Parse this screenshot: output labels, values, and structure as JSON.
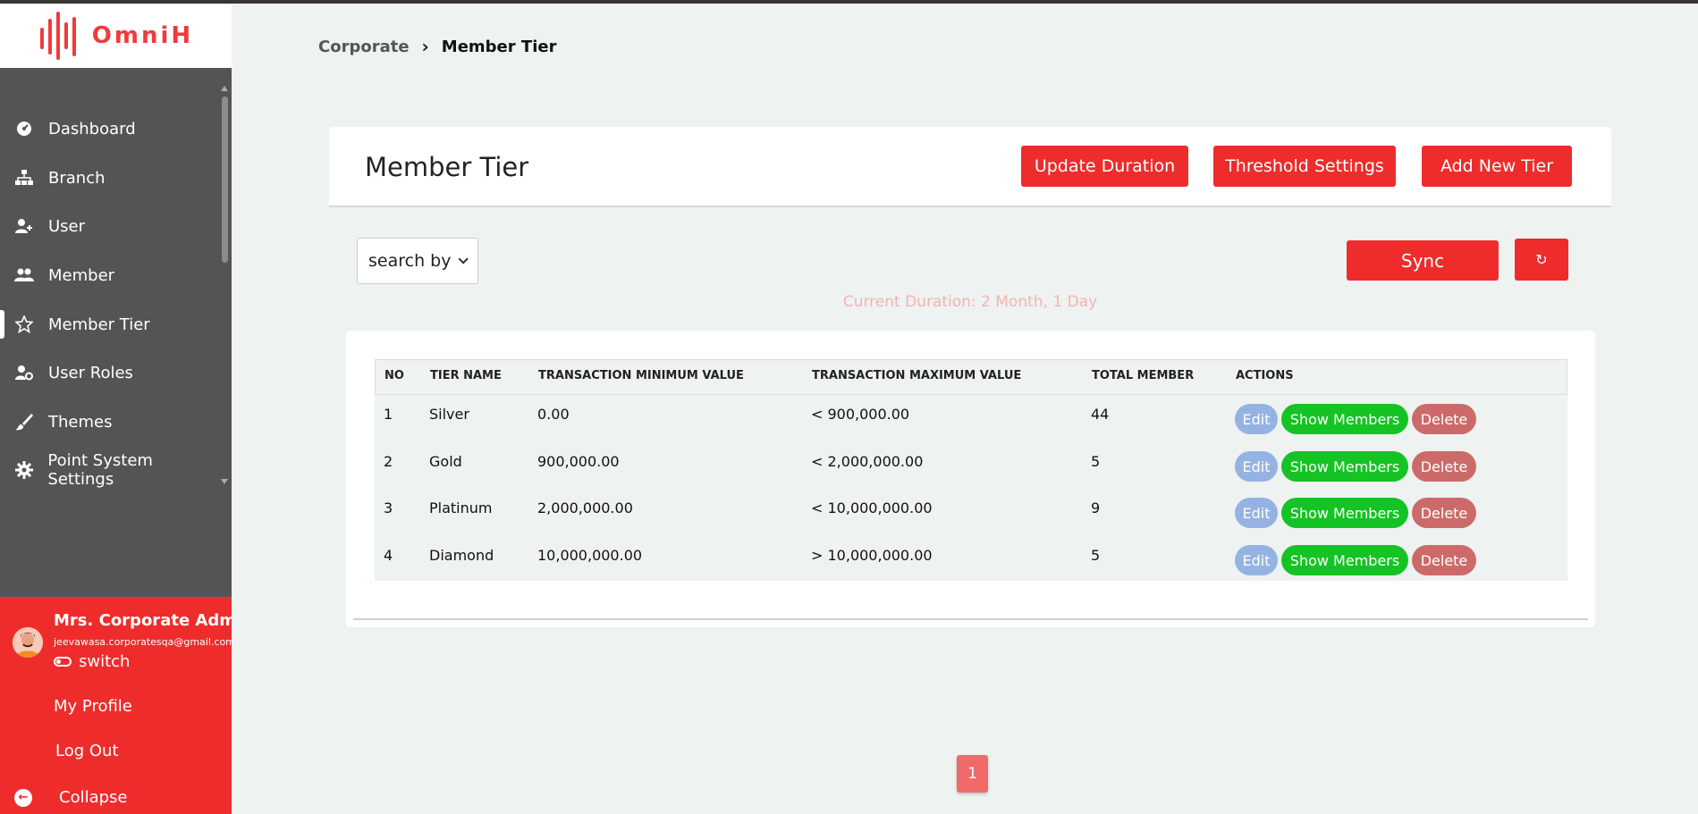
{
  "app": {
    "logo_text": "OmniH"
  },
  "sidebar": {
    "items": [
      {
        "label": "Dashboard",
        "icon": "dashboard-icon"
      },
      {
        "label": "Branch",
        "icon": "sitemap-icon"
      },
      {
        "label": "User",
        "icon": "user-plus-icon"
      },
      {
        "label": "Member",
        "icon": "users-icon"
      },
      {
        "label": "Member Tier",
        "icon": "star-icon",
        "active": true
      },
      {
        "label": "User Roles",
        "icon": "user-gear-icon"
      },
      {
        "label": "Themes",
        "icon": "brush-icon"
      },
      {
        "label": "Point System Settings",
        "icon": "gear-icon"
      }
    ]
  },
  "user_panel": {
    "name": "Mrs. Corporate Admin",
    "email": "jeevawasa.corporatesqa@gmail.com",
    "switch_label": "switch",
    "profile_label": "My Profile",
    "logout_label": "Log Out",
    "collapse_label": "Collapse"
  },
  "breadcrumb": {
    "root": "Corporate",
    "current": "Member Tier"
  },
  "header": {
    "title": "Member Tier",
    "update_duration_label": "Update Duration",
    "threshold_settings_label": "Threshold Settings",
    "add_new_tier_label": "Add New Tier"
  },
  "toolbar": {
    "search_by_label": "search by",
    "sync_label": "Sync",
    "refresh_label": "↻",
    "current_duration": "Current Duration: 2 Month, 1 Day"
  },
  "table": {
    "headers": [
      "NO",
      "TIER NAME",
      "TRANSACTION MINIMUM VALUE",
      "TRANSACTION MAXIMUM VALUE",
      "TOTAL MEMBER",
      "ACTIONS"
    ],
    "rows": [
      {
        "no": "1",
        "name": "Silver",
        "min": "0.00",
        "max": "< 900,000.00",
        "total": "44"
      },
      {
        "no": "2",
        "name": "Gold",
        "min": "900,000.00",
        "max": "< 2,000,000.00",
        "total": "5"
      },
      {
        "no": "3",
        "name": "Platinum",
        "min": "2,000,000.00",
        "max": "< 10,000,000.00",
        "total": "9"
      },
      {
        "no": "4",
        "name": "Diamond",
        "min": "10,000,000.00",
        "max": "> 10,000,000.00",
        "total": "5"
      }
    ],
    "actions": {
      "edit": "Edit",
      "show": "Show Members",
      "delete": "Delete"
    }
  },
  "pagination": {
    "current": "1"
  },
  "colors": {
    "accent": "#ee2c2c",
    "sidebar": "#545454",
    "background": "#eef2f1",
    "success": "#15c324"
  }
}
